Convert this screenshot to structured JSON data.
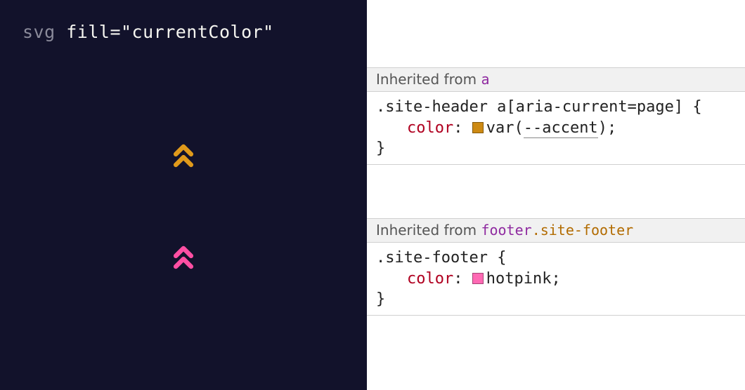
{
  "left": {
    "code": {
      "tag": "svg",
      "attr": "fill",
      "eq": "=",
      "val": "\"currentColor\""
    },
    "icons": [
      {
        "name": "chevrons-up-icon",
        "color": "#e09a1b"
      },
      {
        "name": "chevrons-up-icon",
        "color": "#ff4fa3"
      }
    ]
  },
  "right": {
    "blocks": [
      {
        "inherit_label": "Inherited from",
        "ancestor_tag": "a",
        "ancestor_class": "",
        "selector": ".site-header a[aria-current=page]",
        "prop": "color",
        "swatch": "#cd8a13",
        "value_prefix": "var(",
        "var_name": "--accent",
        "value_suffix": ")",
        "value_plain": ""
      },
      {
        "inherit_label": "Inherited from",
        "ancestor_tag": "footer",
        "ancestor_class": ".site-footer",
        "selector": ".site-footer",
        "prop": "color",
        "swatch": "#ff69b4",
        "value_prefix": "",
        "var_name": "",
        "value_suffix": "",
        "value_plain": "hotpink"
      }
    ]
  }
}
